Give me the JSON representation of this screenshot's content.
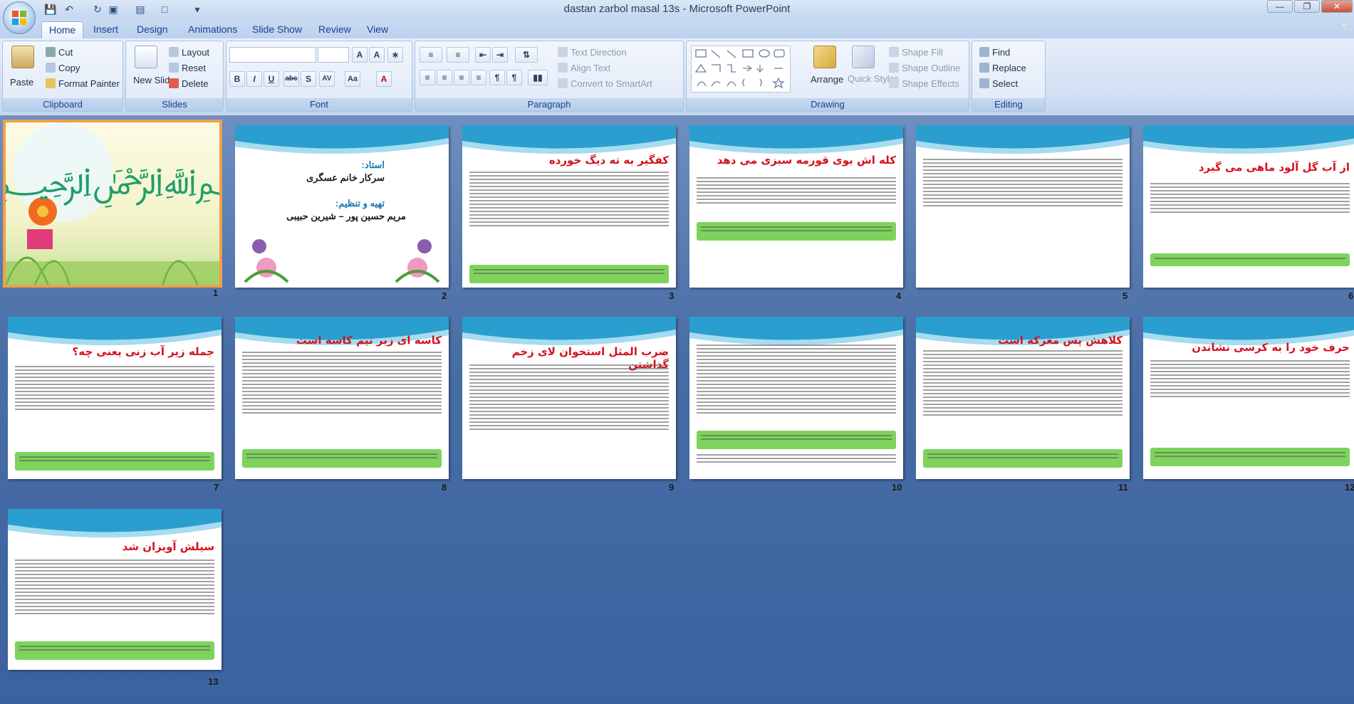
{
  "window": {
    "title": "dastan zarbol masal 13s - Microsoft PowerPoint"
  },
  "tabs": [
    "Home",
    "Insert",
    "Design",
    "Animations",
    "Slide Show",
    "Review",
    "View"
  ],
  "clipboard": {
    "paste": "Paste",
    "cut": "Cut",
    "copy": "Copy",
    "format_painter": "Format Painter",
    "label": "Clipboard"
  },
  "slides_group": {
    "new_slide": "New Slide",
    "layout": "Layout",
    "reset": "Reset",
    "delete": "Delete",
    "label": "Slides"
  },
  "font_group": {
    "label": "Font",
    "bold": "B",
    "italic": "I",
    "underline": "U",
    "strike": "abc",
    "shadow": "S",
    "spacing": "AV",
    "case": "Aa",
    "color": "A"
  },
  "paragraph_group": {
    "text_direction": "Text Direction",
    "align_text": "Align Text",
    "convert": "Convert to SmartArt",
    "label": "Paragraph"
  },
  "drawing_group": {
    "arrange": "Arrange",
    "quick_styles": "Quick Styles",
    "shape_fill": "Shape Fill",
    "shape_outline": "Shape Outline",
    "shape_effects": "Shape Effects",
    "label": "Drawing"
  },
  "editing_group": {
    "find": "Find",
    "replace": "Replace",
    "select": "Select",
    "label": "Editing"
  },
  "slides": [
    {
      "num": "1",
      "title": "",
      "subtitle": ""
    },
    {
      "num": "2",
      "teacher_label": "استاد:",
      "teacher": "سرکار خانم عسگری",
      "author_label": "تهیه و تنظیم:",
      "author": "مریم حسین پور – شیرین حبیبی"
    },
    {
      "num": "3",
      "title": "کفگیر به ته دیگ خورده"
    },
    {
      "num": "4",
      "title": "کله اش بوی قورمه سبزی می دهد"
    },
    {
      "num": "5",
      "title": ""
    },
    {
      "num": "6",
      "title": "از آب گل آلود ماهی می گیرد"
    },
    {
      "num": "7",
      "title": "جمله زیر آب زنی یعنی چه؟"
    },
    {
      "num": "8",
      "title": "کاسه ای زیر نیم کاسه است"
    },
    {
      "num": "9",
      "title": "ضرب المثل استخوان لای زخم گذاشتن"
    },
    {
      "num": "10",
      "title": ""
    },
    {
      "num": "11",
      "title": "کلاهش پس معرکه است"
    },
    {
      "num": "12",
      "title": "حرف خود را به کرسی نشاندن"
    },
    {
      "num": "13",
      "title": "سیلش آویزان شد"
    }
  ]
}
